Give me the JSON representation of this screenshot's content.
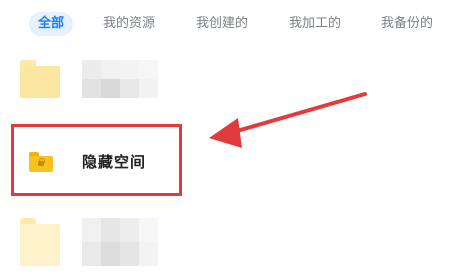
{
  "tabs": [
    {
      "label": "全部",
      "active": true
    },
    {
      "label": "我的资源",
      "active": false
    },
    {
      "label": "我创建的",
      "active": false
    },
    {
      "label": "我加工的",
      "active": false
    },
    {
      "label": "我备份的",
      "active": false
    }
  ],
  "hidden_space": {
    "label": "隐藏空间",
    "icon": "locked-folder-icon"
  },
  "colors": {
    "accent": "#1c7cf3",
    "annotation": "#e23b3b",
    "folder": "#f7c21e"
  }
}
